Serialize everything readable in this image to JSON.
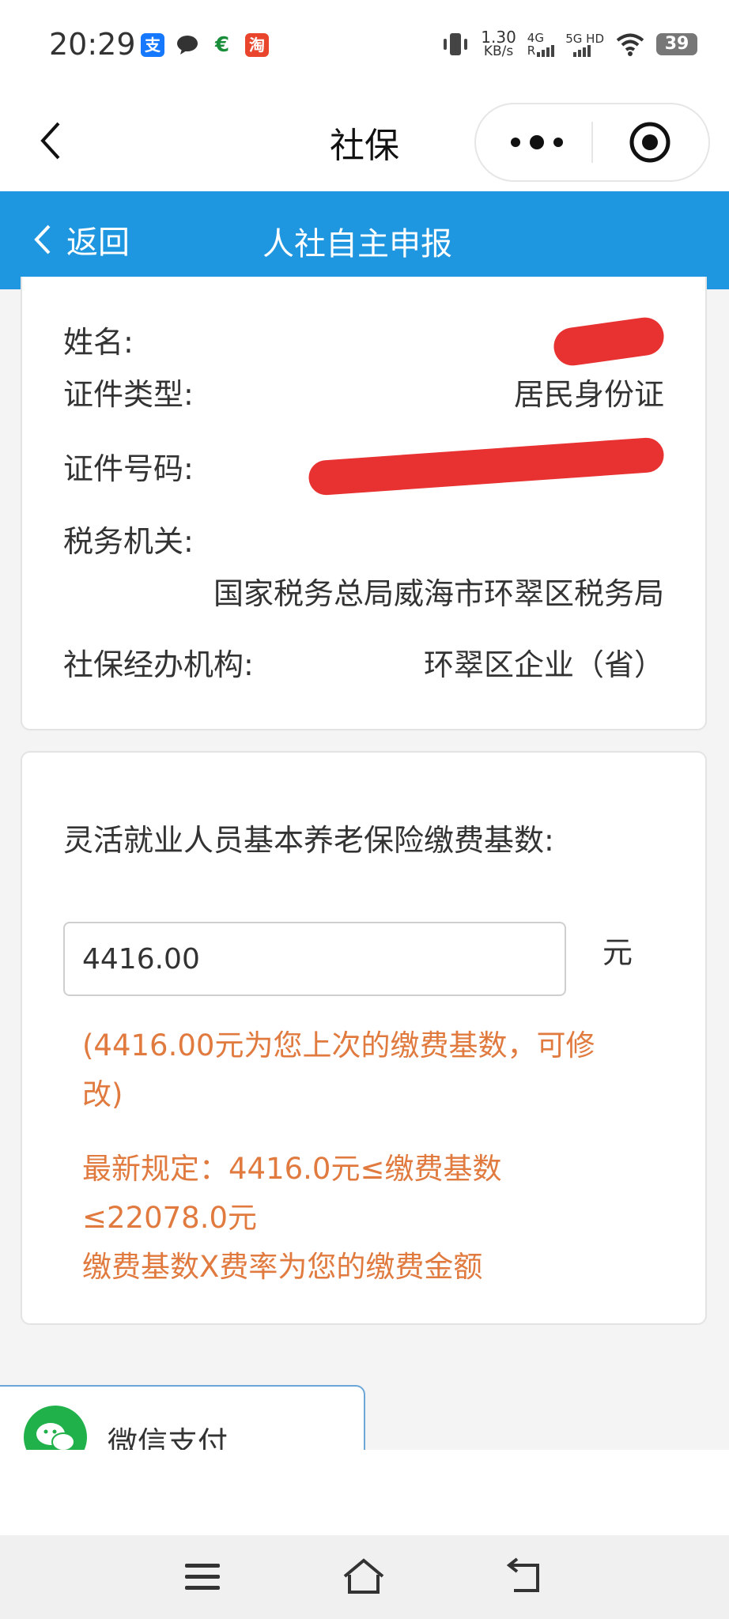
{
  "status_bar": {
    "time": "20:29",
    "app_icons": [
      "alipay-icon",
      "chat-icon",
      "post-bank-icon",
      "taobao-icon"
    ],
    "net_speed_value": "1.30",
    "net_speed_unit": "KB/s",
    "signal_1": "4G",
    "signal_1_sub": "R",
    "signal_2": "5G HD",
    "battery": "39"
  },
  "mp_header": {
    "title": "社保"
  },
  "blue_nav": {
    "back_label": "返回",
    "title": "人社自主申报"
  },
  "info_card": {
    "name_label": "姓名:",
    "id_type_label": "证件类型:",
    "id_type_value": "居民身份证",
    "id_number_label": "证件号码:",
    "tax_office_label": "税务机关:",
    "tax_office_value": "国家税务总局威海市环翠区税务局",
    "agency_label": "社保经办机构:",
    "agency_value": "环翠区企业（省）"
  },
  "base_card": {
    "label": "灵活就业人员基本养老保险缴费基数:",
    "input_value": "4416.00",
    "unit": "元",
    "note_line1": "(4416.00元为您上次的缴费基数，可修",
    "note_line2": "改)",
    "rule_line1": "最新规定：4416.0元≤缴费基数",
    "rule_line2": "≤22078.0元",
    "rule_line3": "缴费基数X费率为您的缴费金额"
  },
  "payment": {
    "label": "微信支付"
  },
  "colors": {
    "accent_blue": "#1e96e0",
    "note_orange": "#e07a3f",
    "redaction_red": "#e83232",
    "wechat_green": "#20b14b"
  }
}
